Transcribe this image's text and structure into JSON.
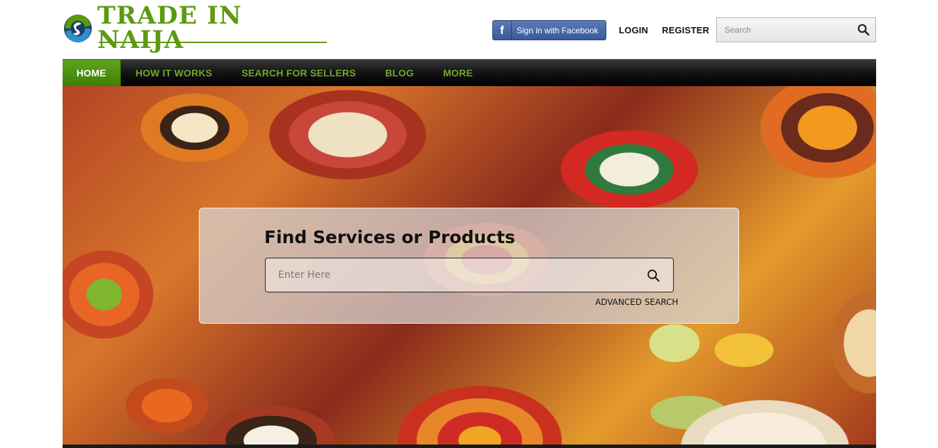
{
  "header": {
    "logo_text": "TRADE IN NAIJA",
    "facebook_button": "Sign in with Facebook",
    "facebook_icon_letter": "f",
    "login": "LOGIN",
    "register": "REGISTER",
    "search_placeholder": "Search"
  },
  "nav": {
    "items": [
      {
        "label": "HOME",
        "active": true
      },
      {
        "label": "HOW IT WORKS"
      },
      {
        "label": "SEARCH FOR SELLERS"
      },
      {
        "label": "BLOG"
      },
      {
        "label": "MORE"
      }
    ]
  },
  "hero": {
    "title": "Find Services or Products",
    "input_placeholder": "Enter Here",
    "advanced_search": "ADVANCED SEARCH"
  },
  "colors": {
    "brand_green": "#5c9a10",
    "facebook_blue": "#3b5998",
    "nav_bg": "#000000"
  }
}
